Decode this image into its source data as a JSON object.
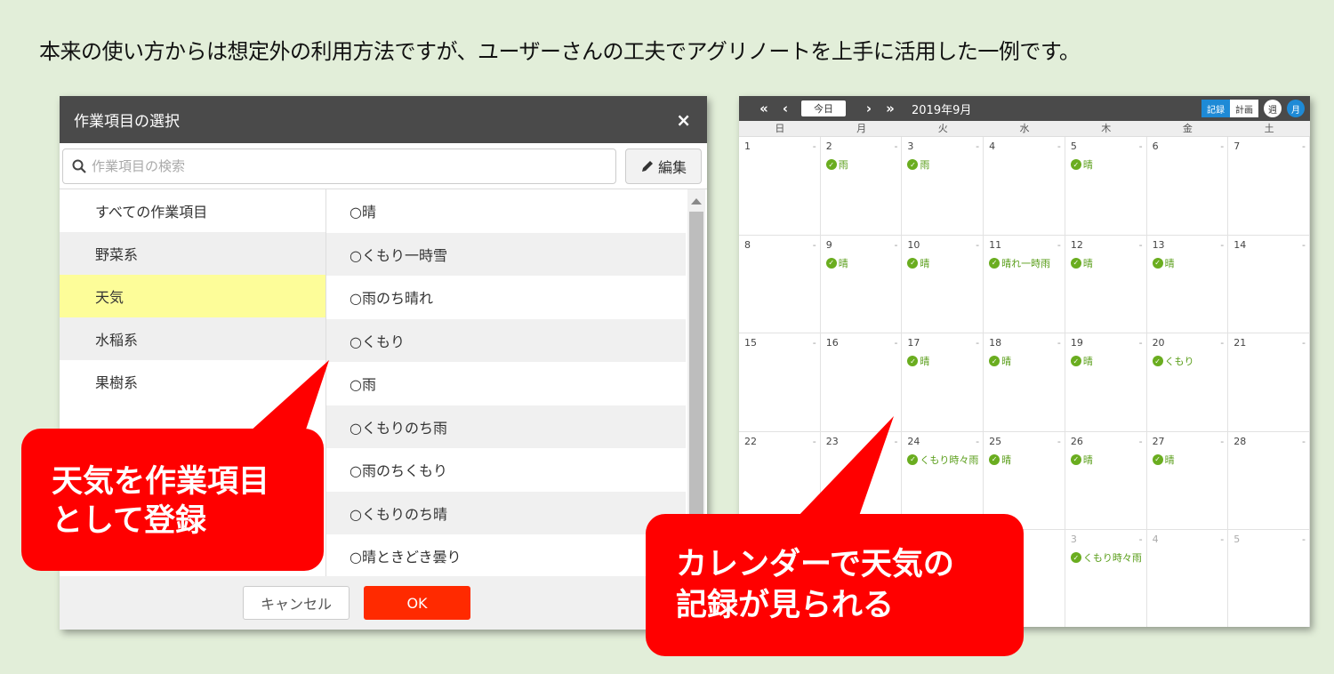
{
  "headline": "本来の使い方からは想定外の利用方法ですが、ユーザーさんの工夫でアグリノートを上手に活用した一例です。",
  "dialog": {
    "title": "作業項目の選択",
    "close": "×",
    "search_placeholder": "作業項目の検索",
    "edit_label": "編集",
    "categories": [
      {
        "label": "すべての作業項目",
        "state": "normal"
      },
      {
        "label": "野菜系",
        "state": "alt"
      },
      {
        "label": "天気",
        "state": "selected"
      },
      {
        "label": "水稲系",
        "state": "alt"
      },
      {
        "label": "果樹系",
        "state": "normal"
      }
    ],
    "items": [
      "○晴",
      "○くもり一時雪",
      "○雨のち晴れ",
      "○くもり",
      "○雨",
      "○くもりのち雨",
      "○雨のちくもり",
      "○くもりのち晴",
      "○晴ときどき曇り"
    ],
    "cancel_label": "キャンセル",
    "ok_label": "OK"
  },
  "calendar": {
    "nav": {
      "first": "«",
      "prev": "‹",
      "today": "今日",
      "next": "›",
      "last": "»"
    },
    "month_title": "2019年9月",
    "mode_record": "記録",
    "mode_plan": "計画",
    "view_week": "週",
    "view_month": "月",
    "weekdays": [
      "日",
      "月",
      "火",
      "水",
      "木",
      "金",
      "土"
    ],
    "weeks": [
      [
        {
          "d": "1",
          "e": ""
        },
        {
          "d": "2",
          "e": "雨"
        },
        {
          "d": "3",
          "e": "雨"
        },
        {
          "d": "4",
          "e": ""
        },
        {
          "d": "5",
          "e": "晴"
        },
        {
          "d": "6",
          "e": ""
        },
        {
          "d": "7",
          "e": ""
        }
      ],
      [
        {
          "d": "8",
          "e": ""
        },
        {
          "d": "9",
          "e": "晴"
        },
        {
          "d": "10",
          "e": "晴"
        },
        {
          "d": "11",
          "e": "晴れ一時雨"
        },
        {
          "d": "12",
          "e": "晴"
        },
        {
          "d": "13",
          "e": "晴"
        },
        {
          "d": "14",
          "e": ""
        }
      ],
      [
        {
          "d": "15",
          "e": ""
        },
        {
          "d": "16",
          "e": ""
        },
        {
          "d": "17",
          "e": "晴"
        },
        {
          "d": "18",
          "e": "晴"
        },
        {
          "d": "19",
          "e": "晴"
        },
        {
          "d": "20",
          "e": "くもり"
        },
        {
          "d": "21",
          "e": ""
        }
      ],
      [
        {
          "d": "22",
          "e": ""
        },
        {
          "d": "23",
          "e": ""
        },
        {
          "d": "24",
          "e": "くもり時々雨"
        },
        {
          "d": "25",
          "e": "晴"
        },
        {
          "d": "26",
          "e": "晴"
        },
        {
          "d": "27",
          "e": "晴"
        },
        {
          "d": "28",
          "e": ""
        }
      ],
      [
        {
          "d": "",
          "e": ""
        },
        {
          "d": "",
          "e": ""
        },
        {
          "d": "",
          "e": ""
        },
        {
          "d": "",
          "e": ""
        },
        {
          "d": "3",
          "e": "くもり時々雨",
          "o": true
        },
        {
          "d": "4",
          "e": "",
          "o": true
        },
        {
          "d": "5",
          "e": "",
          "o": true
        }
      ]
    ]
  },
  "callouts": {
    "left_line1": "天気を作業項目",
    "left_line2": "として登録",
    "right_line1": "カレンダーで天気の",
    "right_line2": "記録が見られる"
  },
  "colors": {
    "background": "#e2eed9",
    "header_dark": "#4a4a4a",
    "selected_category": "#fdfd99",
    "ok_button": "#ff2a00",
    "callout": "#ff0000",
    "event_green": "#6aad1f",
    "accent_blue": "#1e8ad6"
  }
}
